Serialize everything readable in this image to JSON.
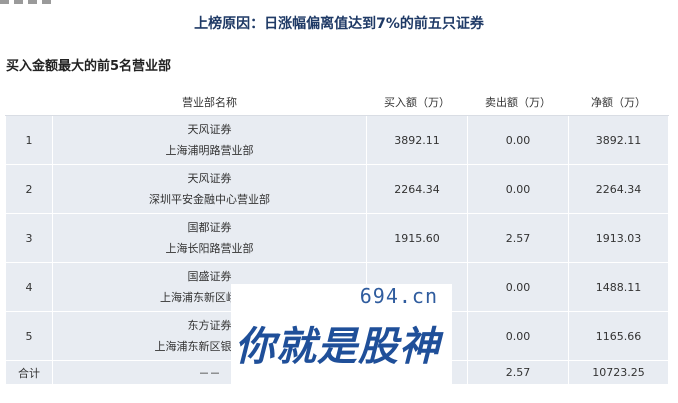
{
  "header": {
    "reason": "上榜原因：日涨幅偏离值达到7%的前五只证券"
  },
  "section": {
    "title": "买入金额最大的前5名营业部"
  },
  "table": {
    "columns": [
      "",
      "营业部名称",
      "买入额（万）",
      "卖出额（万）",
      "净额（万）"
    ],
    "rows": [
      {
        "rank": "1",
        "broker": "天风证券",
        "branch": "上海浦明路营业部",
        "buy": "3892.11",
        "sell": "0.00",
        "net": "3892.11"
      },
      {
        "rank": "2",
        "broker": "天风证券",
        "branch": "深圳平安金融中心营业部",
        "buy": "2264.34",
        "sell": "0.00",
        "net": "2264.34"
      },
      {
        "rank": "3",
        "broker": "国都证券",
        "branch": "上海长阳路营业部",
        "buy": "1915.60",
        "sell": "2.57",
        "net": "1913.03"
      },
      {
        "rank": "4",
        "broker": "国盛证券",
        "branch": "上海浦东新区峨山路",
        "buy": "",
        "sell": "0.00",
        "net": "1488.11"
      },
      {
        "rank": "5",
        "broker": "东方证券",
        "branch": "上海浦东新区银城中路",
        "buy": "",
        "sell": "0.00",
        "net": "1165.66"
      }
    ],
    "total": {
      "label": "合计",
      "dept": "－－",
      "buy": "",
      "sell": "2.57",
      "net": "10723.25"
    }
  },
  "watermark": {
    "url": "694.cn",
    "slogan": "你就是股神"
  }
}
